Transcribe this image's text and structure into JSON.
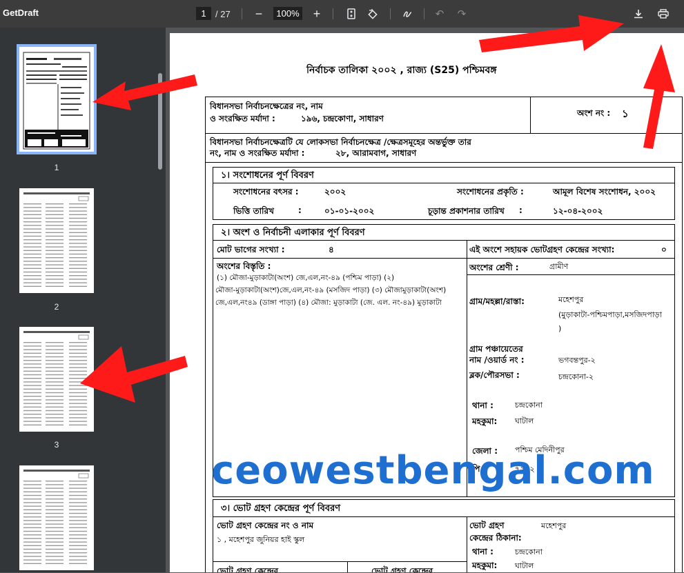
{
  "toolbar": {
    "title": "GetDraft",
    "page_current": "1",
    "page_total": "/ 27",
    "zoom": "100%",
    "zoom_out": "−",
    "zoom_in": "+"
  },
  "sidebar": {
    "thumbnails": [
      {
        "label": "1",
        "selected": true
      },
      {
        "label": "2",
        "selected": false
      },
      {
        "label": "3",
        "selected": false
      },
      {
        "label": "4",
        "selected": false
      }
    ]
  },
  "document": {
    "heading": "নির্বাচক তালিকা   ২০০২ , রাজ্য (S25) পশ্চিমবঙ্গ",
    "ac_label": "বিধানসভা নির্বাচনক্ষেত্রের নং, নাম",
    "ac_label2": "ও সংরক্ষিত মর্যাদা :",
    "ac_value": "১৯৬, চন্দ্রকোণা,  সাধারণ",
    "part_label": "অংশ নং :",
    "part_value": "১",
    "pc_label": "বিধানসভা নির্বাচনক্ষেত্রটি যে লোকসভা নির্বাচনক্ষেত্র /ক্ষেত্রসমূহের অন্তর্ভুক্ত তার",
    "pc_label2": "নং, নাম  ও সংরক্ষিত মর্যাদা :",
    "pc_value": "২৮,  আরামবাগ,  সাধারণ",
    "s1": {
      "title": "১। সংশোধনের পূর্ণ বিবরণ",
      "year_label": "সংশোধনের বৎসর :",
      "year_value": "২০০২",
      "type_label": "সংশোধনের প্রকৃতি :",
      "type_value": "আমূল বিশেষ সংশোধন, ২০০২",
      "base_label": "ভিত্তি তারিখ",
      "base_colon": ":",
      "base_value": "০১-০১-২০০২",
      "pub_label": "চূড়ান্ত প্রকাশনার তারিখ",
      "pub_colon": ":",
      "pub_value": "১২-০৪-২০০২"
    },
    "s2": {
      "title": "২। অংশ ও নির্বাচনী এলাকার পূর্ণ বিবরণ",
      "sections_label": "মোট ভাগের সংখ্যা :",
      "sections_value": "৪",
      "aux_label": "এই অংশে সহায়ক ভোটগ্রহণ কেন্দ্রের সংখ্যা:",
      "aux_value": "০",
      "extent_label": "অংশের বিস্তৃতি  :",
      "extent_lines": [
        "(১) মৌজা-মুড়াকাটা(অংশ) জে,এল,নং-৪৯ (পশ্চিম পাড়া)  (২)",
        "মৌজা-মুড়াকাটা(অংশ)জে,এল,নং-৪৯ (মসজিদ পাড়া)  (৩) মৌজামুড়াকাটা(অংশ)",
        "জে,এল,নং৪৯ (ডাঙ্গা পাড়া)  (৪) মৌজা: মুড়াকাটা (জে. এল. নং-৪৯) মুড়াকাটা"
      ],
      "category_label": "অংশের শ্রেণী :",
      "category_value": "গ্রামীণ",
      "village_label": "গ্রাম/মহল্লা/রাস্তা:",
      "village_value": "মহেশপুর",
      "village_value2": "(মুড়াকাটা-পশ্চিমপাড়া,মসজিদপাড়া",
      "village_value3": ")",
      "gp_label": "গ্রাম পঞ্চায়েতের",
      "gp_label2": "নাম /ওয়ার্ড নং :",
      "gp_value": "ভগবন্তপুর-২",
      "block_label": "ব্লক/পৌরসভা :",
      "block_value": "চন্দ্রকোনা-২",
      "ps_label": "থানা :",
      "ps_value": "চন্দ্রকোনা",
      "sub_label": "মহকুমা:",
      "sub_value": "ঘাটাল",
      "dist_label": "জেলা :",
      "dist_value": "পশ্চিম মেদিনীপুর",
      "pin_label": "পি",
      "pin_value": "৭২১২"
    },
    "s3": {
      "title": "৩। ভোট গ্রহণ কেন্দ্রের পূর্ণ বিবরণ",
      "ps_label": "ভোট গ্রহণ কেন্দ্রের নং ও নাম",
      "ps_value": "১ , মহেশপুর জুনিয়র হাই স্কুল",
      "addr_label": "ভোট গ্রহণ",
      "addr_label2": "কেন্দ্রের ঠিকানা:",
      "addr_value": "মহেশপুর",
      "thana_label": "থানা :",
      "thana_value": "চন্দ্রকোনা",
      "sub_label": "মহকুমা:",
      "sub_value": "ঘাটাল",
      "bottom_left": "ভোট গ্রহণ কেন্দ্রের",
      "bottom_mid": "ভোট গ্রহণ কেন্দ্রের"
    }
  },
  "watermark": "ceowestbengal.com",
  "colors": {
    "arrow": "#ff1a1a",
    "watermark": "#1f6fd1",
    "toolbar": "#3c3c3c",
    "sidebar": "#323639",
    "viewer": "#525659"
  }
}
